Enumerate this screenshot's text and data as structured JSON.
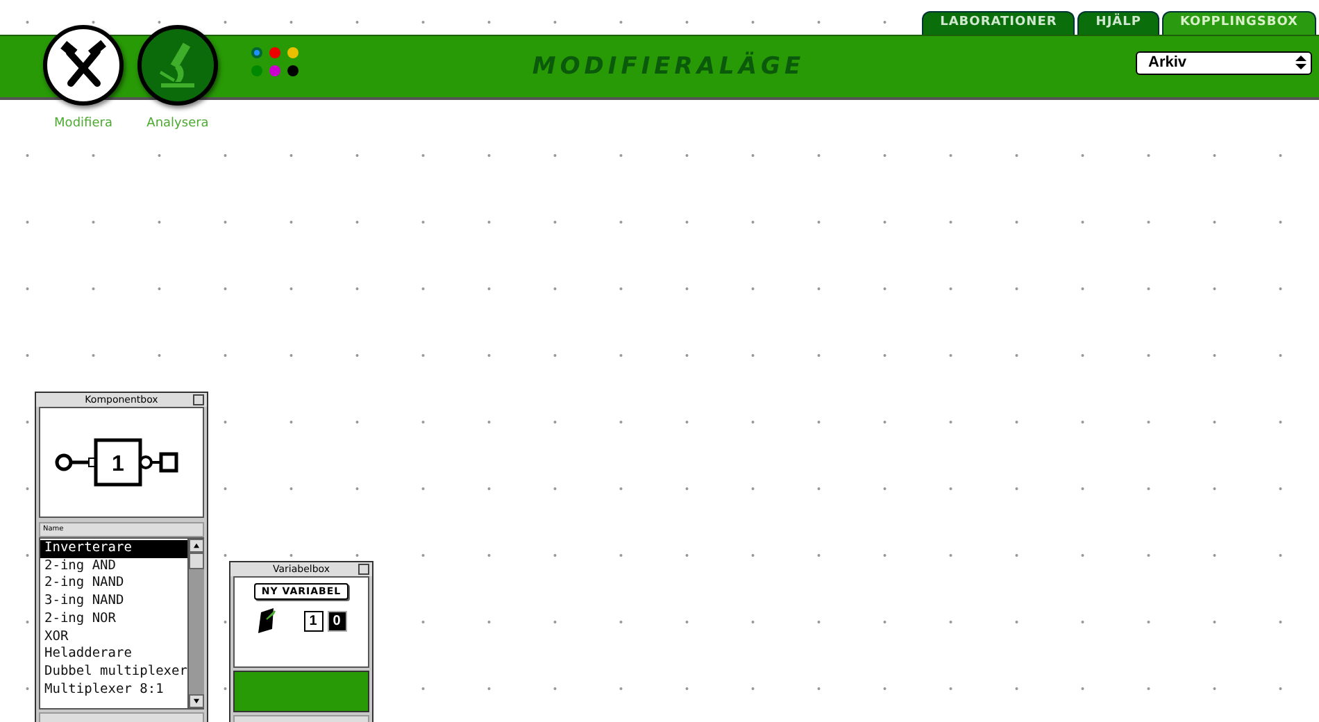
{
  "tabs": [
    {
      "label": "LABORATIONER",
      "selected": false
    },
    {
      "label": "HJÄLP",
      "selected": false
    },
    {
      "label": "KOPPLINGSBOX",
      "selected": true
    }
  ],
  "modes": [
    {
      "kind": "modify",
      "label": "Modifiera",
      "selected": true
    },
    {
      "kind": "analyze",
      "label": "Analysera",
      "selected": false
    }
  ],
  "colors": [
    {
      "color": "#1e90ff",
      "selected": true
    },
    {
      "color": "#ee0000",
      "selected": false
    },
    {
      "color": "#e8c000",
      "selected": false
    },
    {
      "color": "#008800",
      "selected": false
    },
    {
      "color": "#cc00cc",
      "selected": false
    },
    {
      "color": "#000000",
      "selected": false
    }
  ],
  "mode_title": "MODIFIERALÄGE",
  "file_menu": {
    "value": "Arkiv"
  },
  "component_box": {
    "title": "Komponentbox",
    "preview_label": "1",
    "column": "Name",
    "items": [
      {
        "label": "Inverterare",
        "selected": true
      },
      {
        "label": "2-ing AND",
        "selected": false
      },
      {
        "label": "2-ing NAND",
        "selected": false
      },
      {
        "label": "3-ing NAND",
        "selected": false
      },
      {
        "label": "2-ing NOR",
        "selected": false
      },
      {
        "label": "XOR",
        "selected": false
      },
      {
        "label": "Heladderare",
        "selected": false
      },
      {
        "label": "Dubbel multiplexer",
        "selected": false
      },
      {
        "label": "Multiplexer 8:1",
        "selected": false
      }
    ]
  },
  "variable_box": {
    "title": "Variabelbox",
    "new_button": "NY VARIABEL",
    "values": [
      {
        "label": "1",
        "kind": "one"
      },
      {
        "label": "0",
        "kind": "zero"
      }
    ]
  }
}
